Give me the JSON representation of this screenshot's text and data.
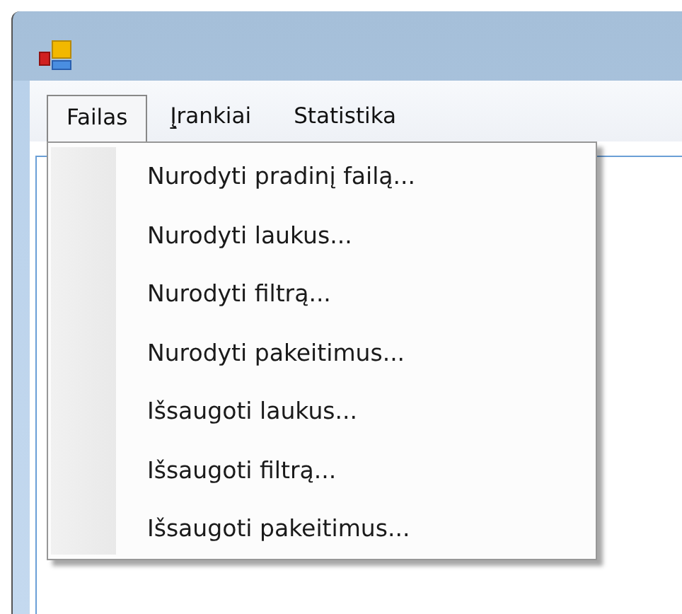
{
  "menu_bar": [
    {
      "label": "Failas",
      "selected": true,
      "mnemonic_underlined": false
    },
    {
      "label": "Įrankiai",
      "selected": false,
      "mnemonic_underlined": true
    },
    {
      "label": "Statistika",
      "selected": false,
      "mnemonic_underlined": false
    }
  ],
  "dropdown": {
    "items": [
      "Nurodyti pradinį failą...",
      "Nurodyti laukus...",
      "Nurodyti filtrą...",
      "Nurodyti pakeitimus...",
      "Išsaugoti laukus...",
      "Išsaugoti filtrą...",
      "Išsaugoti pakeitimus..."
    ]
  }
}
